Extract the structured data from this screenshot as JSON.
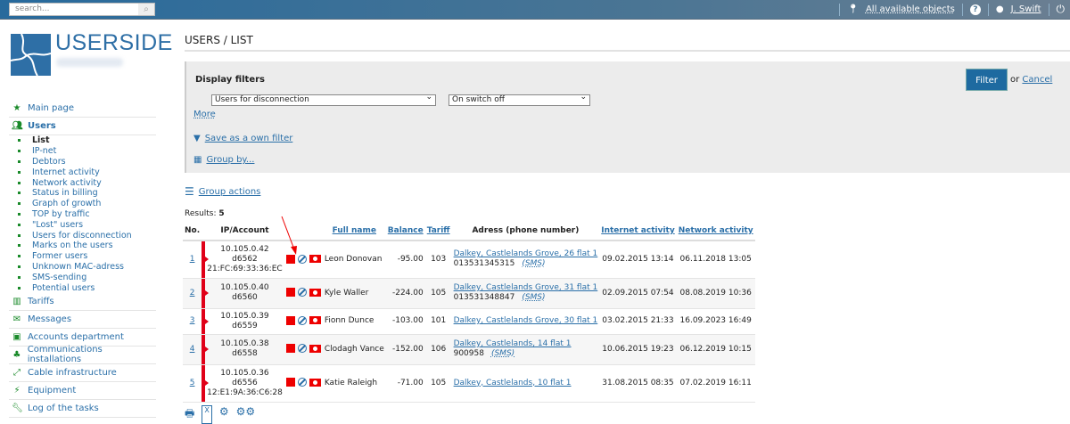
{
  "topbar": {
    "search_placeholder": "search...",
    "objects": "All available objects",
    "help": "?",
    "user": "J. Swift"
  },
  "logo": {
    "text": "USERSIDE"
  },
  "nav": {
    "main": "Main page",
    "users": "Users",
    "sub": [
      "List",
      "IP-net",
      "Debtors",
      "Internet activity",
      "Network activity",
      "Status in billing",
      "Graph of growth",
      "TOP by traffic",
      "\"Lost\" users",
      "Users for disconnection",
      "Marks on the users",
      "Former users",
      "Unknown MAC-adress",
      "SMS-sending",
      "Potential users"
    ],
    "rest": [
      {
        "label": "Tariffs",
        "icon": "chart-icon"
      },
      {
        "label": "Messages",
        "icon": "envelope-icon"
      },
      {
        "label": "Accounts department",
        "icon": "money-icon"
      },
      {
        "label": "Communications installations",
        "icon": "sitemap-icon"
      },
      {
        "label": "Cable infrastructure",
        "icon": "cable-icon"
      },
      {
        "label": "Equipment",
        "icon": "plug-icon"
      },
      {
        "label": "Log of the tasks",
        "icon": "wrench-icon"
      }
    ]
  },
  "page": {
    "title": "USERS / LIST"
  },
  "filters": {
    "heading": "Display filters",
    "select1": "Users for disconnection",
    "select2": "On switch off",
    "more": "More",
    "save": "Save as a own filter",
    "group": "Group by...",
    "filter_btn": "Filter",
    "or": "or",
    "cancel": "Cancel"
  },
  "group_actions": "Group actions",
  "results": {
    "label": "Results:",
    "count": "5"
  },
  "table": {
    "headers": [
      "No.",
      "IP/Account",
      "Full name",
      "Balance",
      "Tariff",
      "Adress (phone number)",
      "Internet activity",
      "Network activity"
    ],
    "rows": [
      {
        "no": "1",
        "ip": "10.105.0.42",
        "acc": "d6562",
        "mac": "21:FC:69:33:36:EC",
        "name": "Leon Donovan",
        "balance": "-95.00",
        "tariff": "103",
        "addr": "Dalkey, Castlelands Grove, 26 flat 1",
        "phone": "013531345315",
        "sms": "(SMS)",
        "inet": "09.02.2015 13:14",
        "net": "06.11.2018 13:05"
      },
      {
        "no": "2",
        "ip": "10.105.0.40",
        "acc": "d6560",
        "mac": "",
        "name": "Kyle Waller",
        "balance": "-224.00",
        "tariff": "105",
        "addr": "Dalkey, Castlelands Grove, 31 flat 1",
        "phone": "013531348847",
        "sms": "(SMS)",
        "inet": "02.09.2015 07:54",
        "net": "08.08.2019 10:36"
      },
      {
        "no": "3",
        "ip": "10.105.0.39",
        "acc": "d6559",
        "mac": "",
        "name": "Fionn Dunce",
        "balance": "-103.00",
        "tariff": "101",
        "addr": "Dalkey, Castlelands Grove, 30 flat 1",
        "phone": "",
        "sms": "",
        "inet": "03.02.2015 21:33",
        "net": "16.09.2023 16:49"
      },
      {
        "no": "4",
        "ip": "10.105.0.38",
        "acc": "d6558",
        "mac": "",
        "name": "Clodagh Vance",
        "balance": "-152.00",
        "tariff": "106",
        "addr": "Dalkey, Castlelands, 14 flat 1",
        "phone": "900958",
        "sms": "(SMS)",
        "inet": "10.06.2015 19:23",
        "net": "06.12.2019 10:15"
      },
      {
        "no": "5",
        "ip": "10.105.0.36",
        "acc": "d6556",
        "mac": "12:E1:9A:36:C6:28",
        "name": "Katie Raleigh",
        "balance": "-71.00",
        "tariff": "105",
        "addr": "Dalkey, Castlelands, 10 flat 1",
        "phone": "",
        "sms": "",
        "inet": "31.08.2015 08:35",
        "net": "07.02.2019 16:11"
      }
    ]
  },
  "colors": {
    "accent": "#2a6fa8",
    "danger": "#e00018",
    "nav_icon": "#1a8a2a"
  }
}
